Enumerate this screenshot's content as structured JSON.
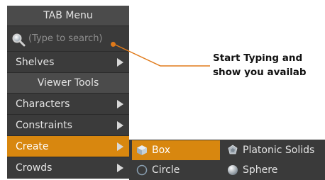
{
  "tab_menu": {
    "title": "TAB Menu",
    "search_placeholder": "(Type to search)",
    "items": [
      {
        "label": "Shelves",
        "has_submenu": true,
        "active": false
      },
      {
        "label": "Viewer Tools",
        "header": true
      },
      {
        "label": "Characters",
        "has_submenu": true,
        "active": false
      },
      {
        "label": "Constraints",
        "has_submenu": true,
        "active": false
      },
      {
        "label": "Create",
        "has_submenu": true,
        "active": true
      },
      {
        "label": "Crowds",
        "has_submenu": true,
        "active": false
      }
    ]
  },
  "create_submenu": {
    "items": [
      {
        "label": "Box",
        "icon": "box-icon",
        "active": true
      },
      {
        "label": "Circle",
        "icon": "circle-icon",
        "active": false
      },
      {
        "label": "Platonic Solids",
        "icon": "platonic-solids-icon",
        "active": false
      },
      {
        "label": "Sphere",
        "icon": "sphere-icon",
        "active": false
      }
    ]
  },
  "callout": {
    "line1": "Start Typing and",
    "line2": "show you availab"
  },
  "colors": {
    "menu_bg": "#3a3a3a",
    "header_bg": "#4b4b4b",
    "highlight": "#d8870f",
    "callout_line": "#e07a1a"
  }
}
